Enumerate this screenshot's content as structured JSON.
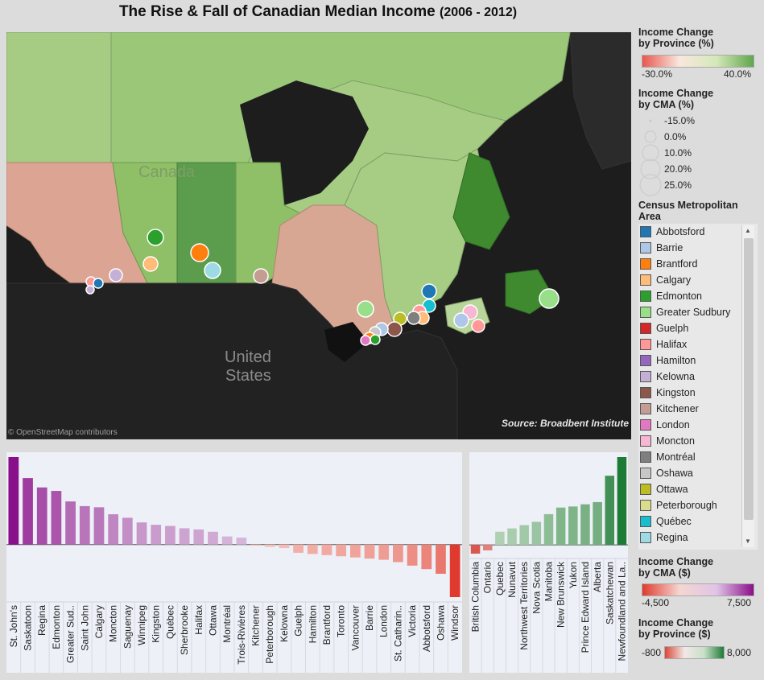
{
  "title": {
    "main": "The Rise & Fall of Canadian Median Income",
    "span": "(2006 - 2012)"
  },
  "map": {
    "country_label_canada": "Canada",
    "country_label_us_1": "United",
    "country_label_us_2": "States",
    "source": "Source: Broadbent Institute",
    "attribution": "© OpenStreetMap contributors"
  },
  "legend": {
    "province_pct": {
      "title_1": "Income Change",
      "title_2": "by Province (%)",
      "min": "-30.0%",
      "max": "40.0%",
      "colors": [
        "#e8574f",
        "#f9e7de",
        "#d4e8b8",
        "#5fa64c"
      ]
    },
    "cma_pct_size": {
      "title_1": "Income Change",
      "title_2": "by CMA (%)",
      "items": [
        "-15.0%",
        "0.0%",
        "10.0%",
        "20.0%",
        "25.0%"
      ]
    },
    "cma": {
      "title_1": "Census Metropolitan",
      "title_2": "Area",
      "items": [
        {
          "name": "Abbotsford",
          "color": "#1f77b4"
        },
        {
          "name": "Barrie",
          "color": "#aec7e8"
        },
        {
          "name": "Brantford",
          "color": "#ff7f0e"
        },
        {
          "name": "Calgary",
          "color": "#ffbb78"
        },
        {
          "name": "Edmonton",
          "color": "#2ca02c"
        },
        {
          "name": "Greater Sudbury",
          "color": "#98df8a"
        },
        {
          "name": "Guelph",
          "color": "#d62728"
        },
        {
          "name": "Halifax",
          "color": "#ff9896"
        },
        {
          "name": "Hamilton",
          "color": "#9467bd"
        },
        {
          "name": "Kelowna",
          "color": "#c5b0d5"
        },
        {
          "name": "Kingston",
          "color": "#8c564b"
        },
        {
          "name": "Kitchener",
          "color": "#c49c94"
        },
        {
          "name": "London",
          "color": "#e377c2"
        },
        {
          "name": "Moncton",
          "color": "#f7b6d2"
        },
        {
          "name": "Montréal",
          "color": "#7f7f7f"
        },
        {
          "name": "Oshawa",
          "color": "#c7c7c7"
        },
        {
          "name": "Ottawa",
          "color": "#bcbd22"
        },
        {
          "name": "Peterborough",
          "color": "#dbdb8d"
        },
        {
          "name": "Québec",
          "color": "#17becf"
        },
        {
          "name": "Regina",
          "color": "#9edae5"
        }
      ]
    },
    "cma_dollar": {
      "title_1": "Income Change",
      "title_2": "by CMA ($)",
      "min": "-4,500",
      "max": "7,500",
      "colors": [
        "#e03a2f",
        "#f5d6d0",
        "#e0c4e6",
        "#8a0f8a"
      ]
    },
    "province_dollar": {
      "title_1": "Income Change",
      "title_2": "by Province ($)",
      "min": "-800",
      "max": "8,000",
      "colors": [
        "#d94838",
        "#f1e8e6",
        "#c8dfc8",
        "#1e7b36"
      ]
    }
  },
  "chart_data": [
    {
      "type": "bar",
      "title": "",
      "categories": [
        "St. John's",
        "Saskatoon",
        "Regina",
        "Edmonton",
        "Greater Sud..",
        "Saint John",
        "Calgary",
        "Moncton",
        "Saguenay",
        "Winnipeg",
        "Kingston",
        "Québec",
        "Sherbrooke",
        "Halifax",
        "Ottawa",
        "Montréal",
        "Trois-Rivières",
        "Kitchener",
        "Peterborough",
        "Kelowna",
        "Guelph",
        "Hamilton",
        "Brantford",
        "Toronto",
        "Vancouver",
        "Barrie",
        "London",
        "St. Catharin..",
        "Victoria",
        "Abbotsford",
        "Oshawa",
        "Windsor"
      ],
      "values": [
        7500,
        5700,
        4900,
        4600,
        3700,
        3300,
        3200,
        2600,
        2300,
        1900,
        1700,
        1600,
        1400,
        1300,
        1100,
        700,
        600,
        -100,
        -200,
        -300,
        -700,
        -800,
        -900,
        -1000,
        -1100,
        -1200,
        -1300,
        -1500,
        -1800,
        -2100,
        -2500,
        -4500
      ],
      "ylim": [
        -4500,
        7500
      ]
    },
    {
      "type": "bar",
      "title": "",
      "categories": [
        "British Columbia",
        "Ontario",
        "Quebec",
        "Nunavut",
        "Northwest Territories",
        "Nova Scotia",
        "Manitoba",
        "New Brunswick",
        "Yukon",
        "Prince Edward Island",
        "Alberta",
        "Saskatchewan",
        "Newfoundland and La.."
      ],
      "values": [
        -800,
        -500,
        1200,
        1500,
        1800,
        2100,
        2800,
        3400,
        3500,
        3700,
        3900,
        6300,
        8000
      ],
      "ylim": [
        -800,
        8000
      ]
    }
  ]
}
